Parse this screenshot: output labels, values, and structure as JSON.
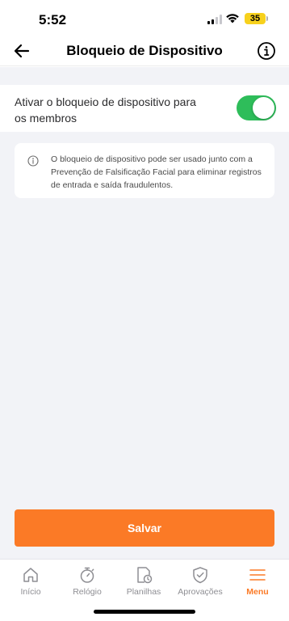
{
  "status_bar": {
    "time": "5:52",
    "battery": "35",
    "icons": [
      "signal-icon",
      "wifi-icon",
      "battery-icon"
    ]
  },
  "header": {
    "title": "Bloqueio de Dispositivo",
    "back_icon": "arrow-left-icon",
    "info_icon": "info-icon"
  },
  "setting": {
    "label": "Ativar o bloqueio de dispositivo para os membros",
    "enabled": true,
    "toggle_color": "#2ebd5a"
  },
  "info_card": {
    "icon": "info-icon",
    "text": "O bloqueio de dispositivo pode ser usado junto com a Prevenção de Falsificação Facial para eliminar registros de entrada e saída fraudulentos."
  },
  "actions": {
    "save_label": "Salvar",
    "save_color": "#fb7a26"
  },
  "tab_bar": {
    "items": [
      {
        "label": "Início",
        "icon": "home-icon",
        "active": false
      },
      {
        "label": "Relógio",
        "icon": "stopwatch-icon",
        "active": false
      },
      {
        "label": "Planilhas",
        "icon": "timesheet-icon",
        "active": false
      },
      {
        "label": "Aprovações",
        "icon": "shield-check-icon",
        "active": false
      },
      {
        "label": "Menu",
        "icon": "menu-icon",
        "active": true
      }
    ],
    "active_color": "#fb7a26"
  }
}
